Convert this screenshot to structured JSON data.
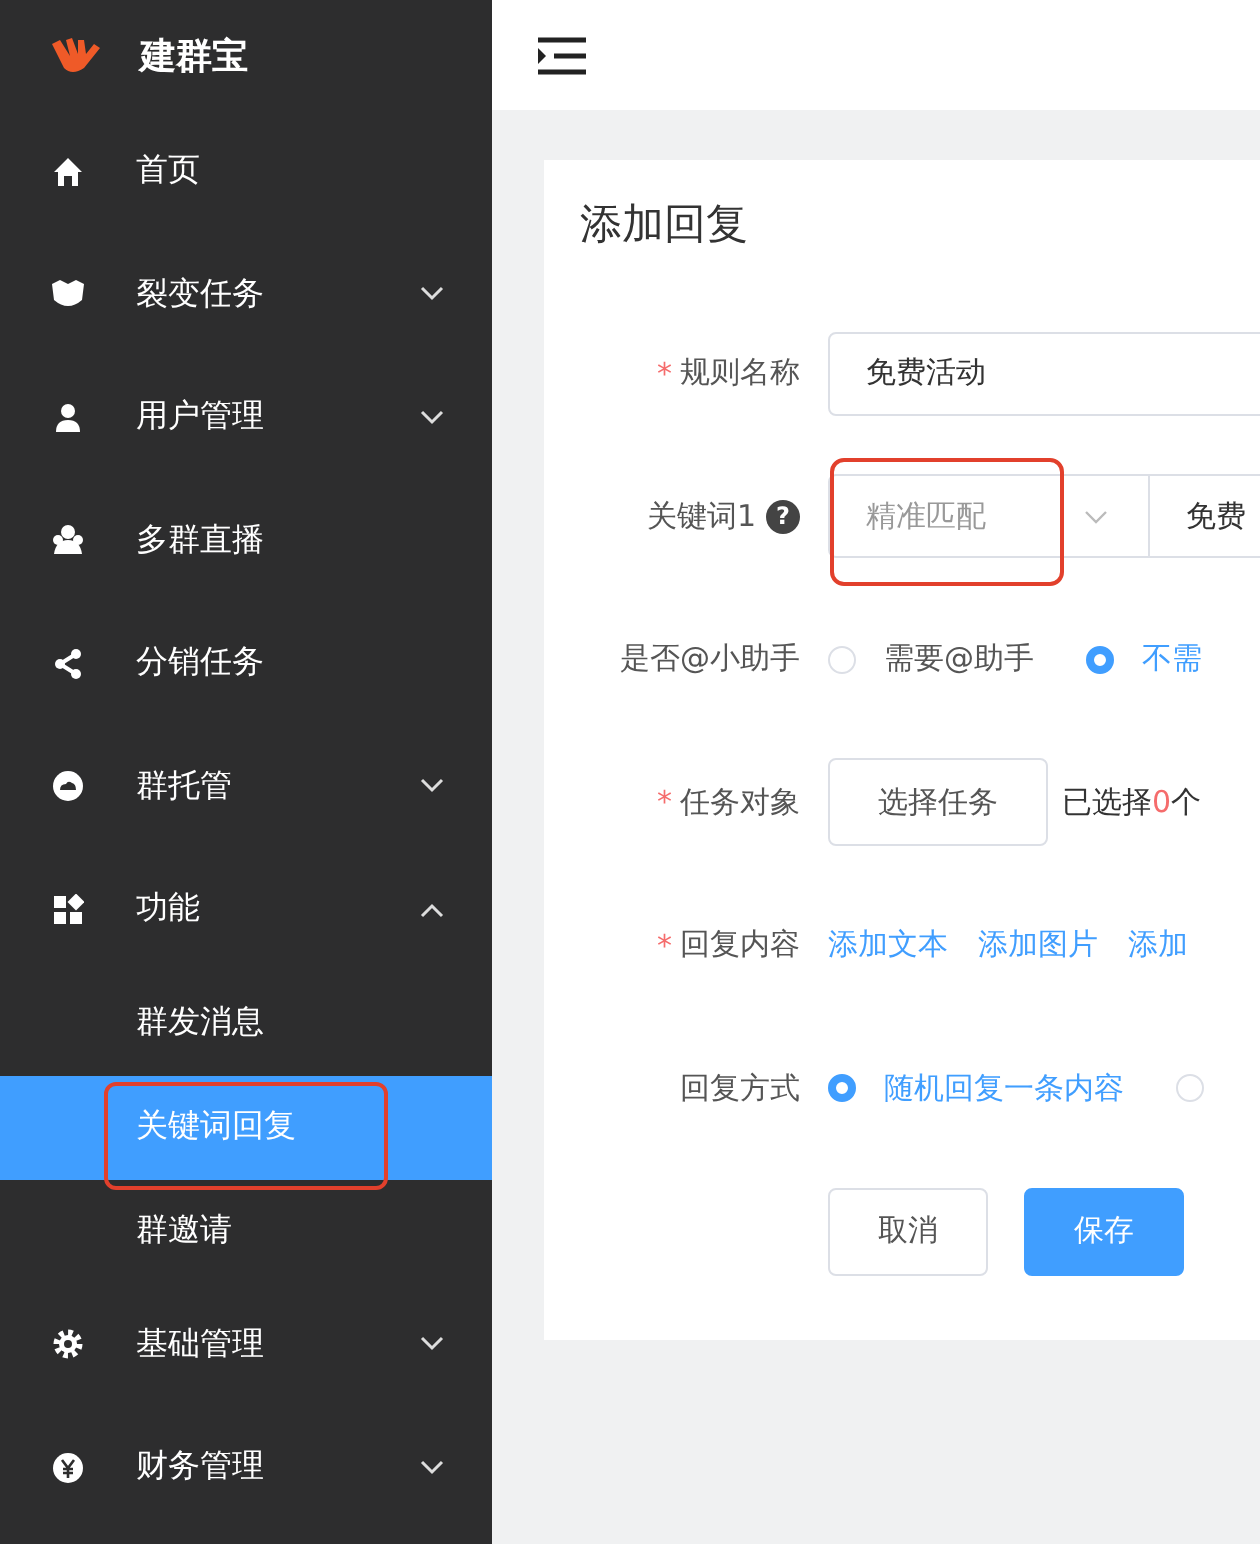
{
  "app": {
    "name": "建群宝"
  },
  "sidebar": {
    "items": [
      {
        "label": "首页",
        "kind": "link",
        "selected": false
      },
      {
        "label": "裂变任务",
        "kind": "group",
        "expanded": false,
        "selected": false
      },
      {
        "label": "用户管理",
        "kind": "group",
        "expanded": false,
        "selected": false
      },
      {
        "label": "多群直播",
        "kind": "link",
        "selected": false
      },
      {
        "label": "分销任务",
        "kind": "link",
        "selected": false
      },
      {
        "label": "群托管",
        "kind": "group",
        "expanded": false,
        "selected": false
      },
      {
        "label": "功能",
        "kind": "group",
        "expanded": true,
        "selected": false,
        "children": [
          {
            "label": "群发消息",
            "selected": false,
            "highlighted": false
          },
          {
            "label": "关键词回复",
            "selected": true,
            "highlighted": true
          },
          {
            "label": "群邀请",
            "selected": false,
            "highlighted": false
          }
        ]
      },
      {
        "label": "基础管理",
        "kind": "group",
        "expanded": false,
        "selected": false
      },
      {
        "label": "财务管理",
        "kind": "group",
        "expanded": false,
        "selected": false
      }
    ]
  },
  "form": {
    "title": "添加回复",
    "rows": [
      {
        "kind": "input",
        "label": "规则名称",
        "required_mark": "*",
        "value": "免费活动"
      },
      {
        "kind": "keyword",
        "label": "关键词1",
        "help": "?",
        "match": "精准匹配",
        "match_highlighted": true,
        "value": "免费"
      },
      {
        "kind": "radio",
        "label": "是否@小助手",
        "options": [
          {
            "label": "需要@助手",
            "selected": false
          },
          {
            "label": "不需",
            "selected": true
          }
        ]
      },
      {
        "kind": "task",
        "label": "任务对象",
        "required_mark": "*",
        "button": "选择任务",
        "summary_prefix": "已选择",
        "count": "0",
        "summary_suffix": "个"
      },
      {
        "kind": "links",
        "label": "回复内容",
        "required_mark": "*",
        "links": [
          "添加文本",
          "添加图片",
          "添加"
        ]
      },
      {
        "kind": "radio",
        "label": "回复方式",
        "options": [
          {
            "label": "随机回复一条内容",
            "selected": true
          },
          {
            "selected": false
          }
        ]
      }
    ],
    "buttons": [
      {
        "label": "取消",
        "kind": "default"
      },
      {
        "label": "保存",
        "kind": "primary"
      }
    ]
  }
}
